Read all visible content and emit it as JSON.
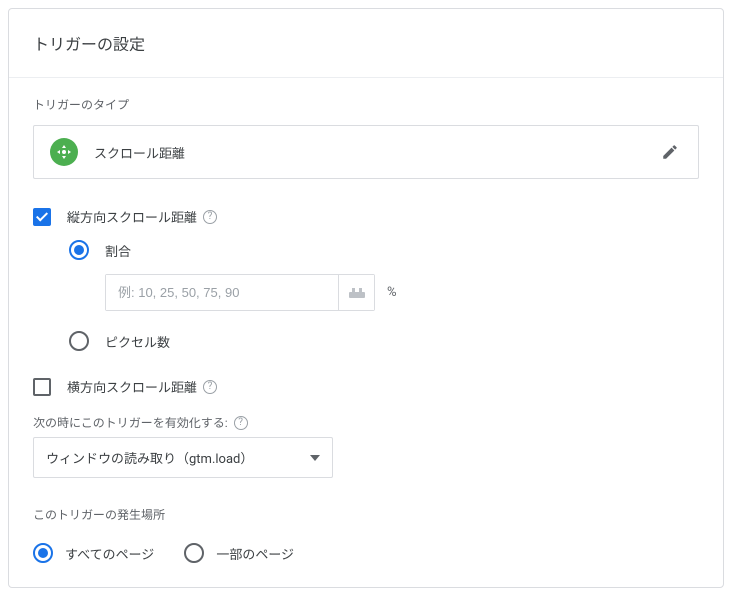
{
  "header": {
    "title": "トリガーの設定"
  },
  "type": {
    "label": "トリガーのタイプ",
    "name": "スクロール距離"
  },
  "vertical": {
    "label": "縦方向スクロール距離",
    "ratio_label": "割合",
    "pixel_label": "ピクセル数",
    "input_placeholder": "例: 10, 25, 50, 75, 90",
    "suffix": "%"
  },
  "horizontal": {
    "label": "横方向スクロール距離"
  },
  "enable_timing": {
    "label": "次の時にこのトリガーを有効化する:",
    "value": "ウィンドウの読み取り（gtm.load）"
  },
  "fires_on": {
    "label": "このトリガーの発生場所",
    "all": "すべてのページ",
    "some": "一部のページ"
  },
  "icons": {
    "help": "?"
  }
}
